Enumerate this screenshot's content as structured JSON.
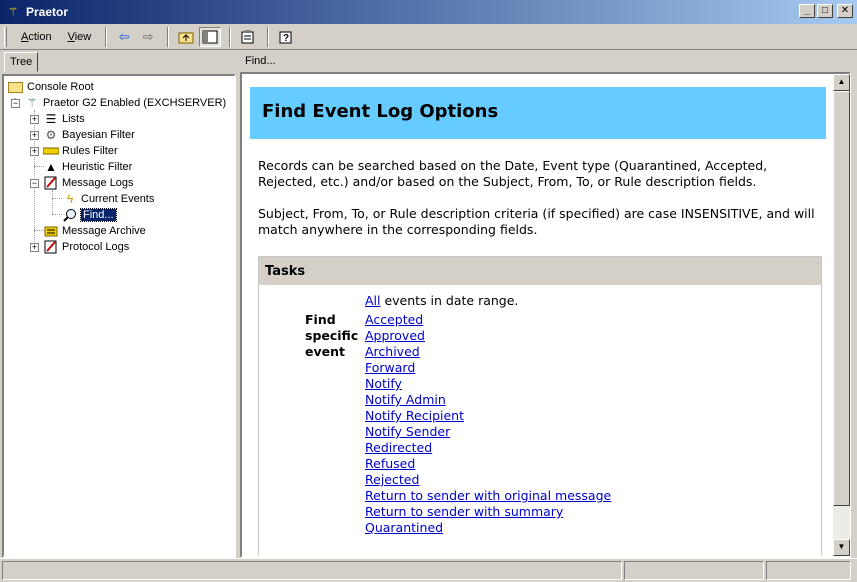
{
  "window": {
    "title": "Praetor",
    "minimize": "_",
    "maximize": "□",
    "close": "✕"
  },
  "menu": {
    "action": "Action",
    "action_accel": "A",
    "view": "View",
    "view_accel": "V"
  },
  "toolbar": {
    "icons": [
      "back-arrow-icon",
      "forward-arrow-icon",
      "up-folder-icon",
      "show-hide-tree-icon",
      "properties-icon",
      "help-icon"
    ]
  },
  "left_pane": {
    "tab": "Tree",
    "tree": [
      {
        "label": "Console Root",
        "icon": "folder-icon"
      },
      {
        "label": "Praetor G2 Enabled (EXCHSERVER)",
        "icon": "praetor-icon",
        "expander": "−"
      },
      {
        "label": "Lists",
        "icon": "lists-icon",
        "expander": "+"
      },
      {
        "label": "Bayesian Filter",
        "icon": "bayesian-icon",
        "expander": "+"
      },
      {
        "label": "Rules Filter",
        "icon": "rules-icon",
        "expander": "+"
      },
      {
        "label": "Heuristic Filter",
        "icon": "heuristic-icon"
      },
      {
        "label": "Message Logs",
        "icon": "logs-icon",
        "expander": "−"
      },
      {
        "label": "Current Events",
        "icon": "lightning-icon"
      },
      {
        "label": "Find...",
        "icon": "magnifier-icon",
        "selected": true
      },
      {
        "label": "Message Archive",
        "icon": "archive-icon"
      },
      {
        "label": "Protocol Logs",
        "icon": "protocol-logs-icon",
        "expander": "+"
      }
    ]
  },
  "right_pane": {
    "header": "Find...",
    "banner_title": "Find Event Log Options",
    "paragraph1": "Records can be searched based on the Date, Event type (Quarantined, Accepted, Rejected, etc.) and/or based on the Subject, From, To, or Rule description fields.",
    "paragraph2": "Subject, From, To, or Rule description criteria (if specified) are case INSENSITIVE, and will match anywhere in the corresponding fields.",
    "tasks": {
      "header": "Tasks",
      "all_link": "All",
      "all_suffix": " events in date range.",
      "find_label": "Find specific event",
      "events": [
        "Accepted",
        "Approved",
        "Archived",
        "Forward",
        "Notify",
        "Notify Admin",
        "Notify Recipient",
        "Notify Sender",
        "Redirected",
        "Refused",
        "Rejected",
        "Return to sender with original message",
        "Return to sender with summary",
        "Quarantined"
      ]
    }
  },
  "colors": {
    "banner": "#66ccff",
    "selection": "#0a246a",
    "link": "#0000cc",
    "titlebar": "#0a246a"
  }
}
